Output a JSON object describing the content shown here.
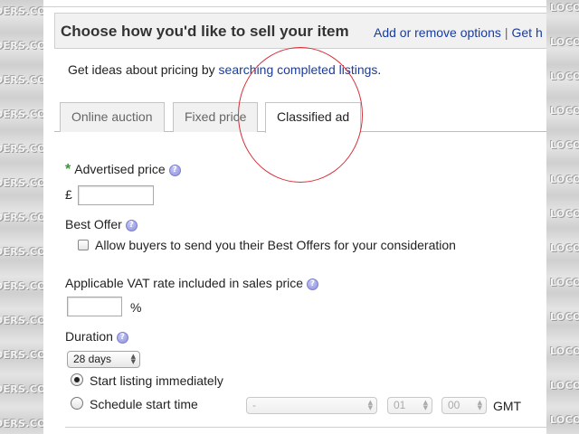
{
  "watermark": {
    "left_text": "DERS.CO.",
    "right_text": "LOCOST"
  },
  "section": {
    "title": "Choose how you'd like to sell your item",
    "add_remove_link": "Add or remove options",
    "separator": "|",
    "get_help_link": "Get h"
  },
  "ideas": {
    "prefix": "Get ideas about pricing by ",
    "link": "searching completed listings",
    "suffix": "."
  },
  "tabs": [
    {
      "label": "Online auction",
      "active": false
    },
    {
      "label": "Fixed price",
      "active": false
    },
    {
      "label": "Classified ad",
      "active": true
    }
  ],
  "advertised_price": {
    "required_mark": "*",
    "label": "Advertised price",
    "currency": "£",
    "value": ""
  },
  "best_offer": {
    "label": "Best Offer",
    "checkbox_label": "Allow buyers to send you their Best Offers for your consideration",
    "checked": false
  },
  "vat": {
    "label": "Applicable VAT rate included in sales price",
    "value": "",
    "unit": "%"
  },
  "duration": {
    "label": "Duration",
    "selected": "28 days"
  },
  "start": {
    "immediate_label": "Start listing immediately",
    "schedule_label": "Schedule start time",
    "selected": "immediate",
    "date_value": "-",
    "hour_value": "01",
    "minute_value": "00",
    "timezone": "GMT"
  },
  "colors": {
    "link": "#1a3c9c",
    "required": "#2f9b2f",
    "annotation_circle": "#d8303a"
  }
}
